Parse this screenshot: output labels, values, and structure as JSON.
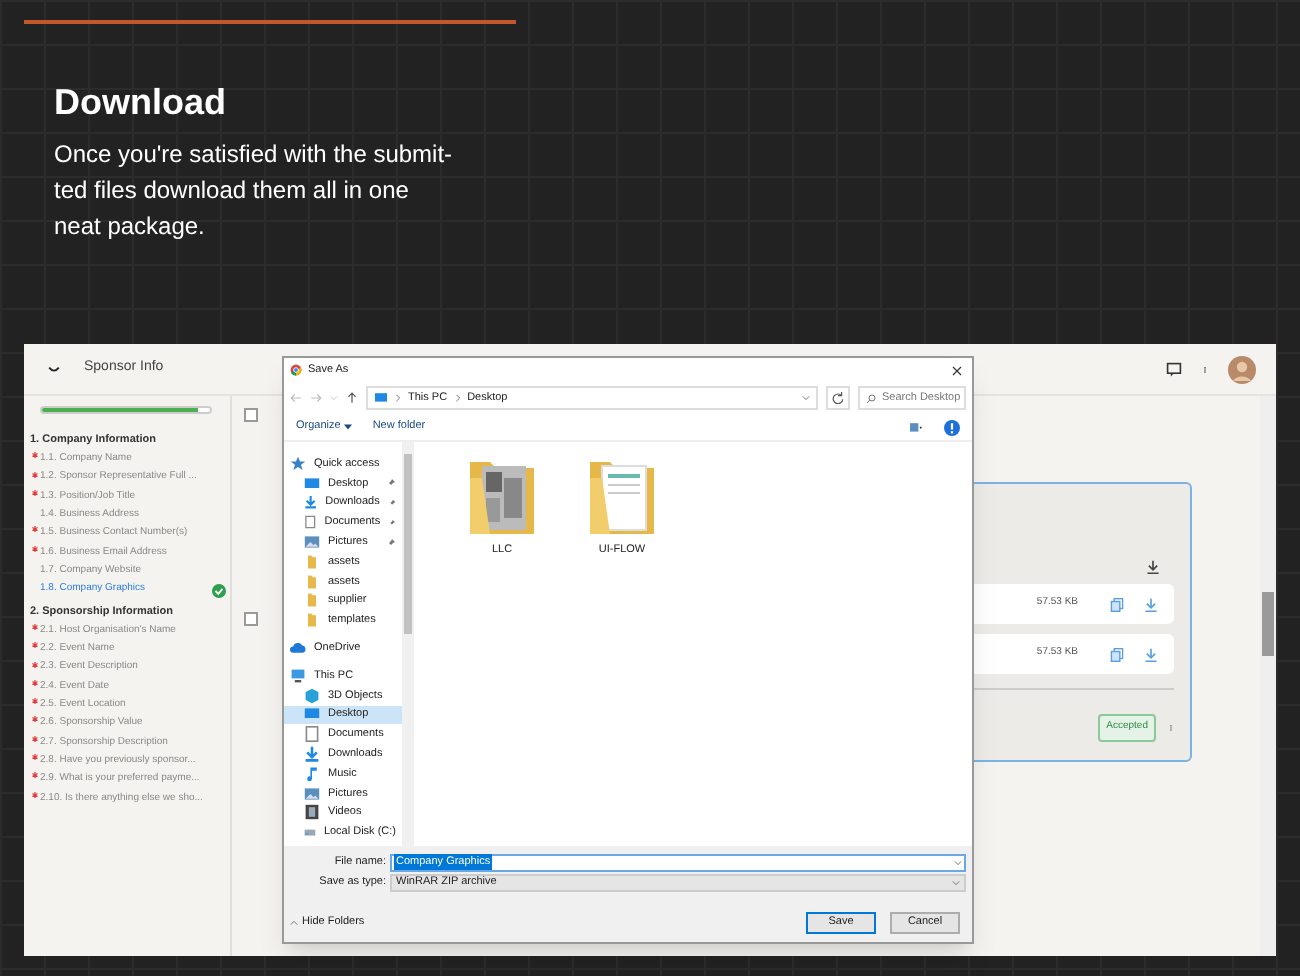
{
  "slide": {
    "title": "Download",
    "lines": [
      "Once you're satisfied with the submit-",
      "ted files download them all in one",
      "neat package."
    ]
  },
  "app": {
    "title": "Sponsor Info",
    "progress": {
      "level": 0.93
    },
    "sections": [
      {
        "number": "1.",
        "title": "Company Information",
        "items": [
          {
            "number": "1.1.",
            "label": "Company Name",
            "required": true,
            "selected": false,
            "completed": false
          },
          {
            "number": "1.2.",
            "label": "Sponsor Representative Full ...",
            "required": true,
            "selected": false,
            "completed": false
          },
          {
            "number": "1.3.",
            "label": "Position/Job Title",
            "required": true,
            "selected": false,
            "completed": false
          },
          {
            "number": "1.4.",
            "label": "Business Address",
            "required": false,
            "selected": false,
            "completed": false
          },
          {
            "number": "1.5.",
            "label": "Business Contact Number(s)",
            "required": true,
            "selected": false,
            "completed": false
          },
          {
            "number": "1.6.",
            "label": "Business Email Address",
            "required": true,
            "selected": false,
            "completed": false
          },
          {
            "number": "1.7.",
            "label": "Company Website",
            "required": false,
            "selected": false,
            "completed": false
          },
          {
            "number": "1.8.",
            "label": "Company Graphics",
            "required": false,
            "selected": true,
            "completed": true
          }
        ]
      },
      {
        "number": "2.",
        "title": "Sponsorship Information",
        "items": [
          {
            "number": "2.1.",
            "label": "Host Organisation's Name",
            "required": true,
            "selected": false,
            "completed": false
          },
          {
            "number": "2.2.",
            "label": "Event Name",
            "required": true,
            "selected": false,
            "completed": false
          },
          {
            "number": "2.3.",
            "label": "Event Description",
            "required": true,
            "selected": false,
            "completed": false
          },
          {
            "number": "2.4.",
            "label": "Event Date",
            "required": true,
            "selected": false,
            "completed": false
          },
          {
            "number": "2.5.",
            "label": "Event Location",
            "required": true,
            "selected": false,
            "completed": false
          },
          {
            "number": "2.6.",
            "label": "Sponsorship Value",
            "required": true,
            "selected": false,
            "completed": false
          },
          {
            "number": "2.7.",
            "label": "Sponsorship Description",
            "required": true,
            "selected": false,
            "completed": false
          },
          {
            "number": "2.8.",
            "label": "Have you previously sponsor...",
            "required": true,
            "selected": false,
            "completed": false
          },
          {
            "number": "2.9.",
            "label": "What is your preferred payme...",
            "required": true,
            "selected": false,
            "completed": false
          },
          {
            "number": "2.10.",
            "label": "Is there anything else we sho...",
            "required": true,
            "selected": false,
            "completed": false
          }
        ]
      }
    ],
    "checkboxes": [
      {
        "checked": false
      },
      {
        "checked": false
      }
    ],
    "files": [
      {
        "size": "57.53 KB"
      },
      {
        "size": "57.53 KB"
      }
    ],
    "status": "Accepted"
  },
  "dialog": {
    "title": "Save As",
    "path": [
      "This PC",
      "Desktop"
    ],
    "search_placeholder": "Search Desktop",
    "organize": "Organize",
    "new_folder": "New folder",
    "nav": [
      {
        "label": "Quick access",
        "kind": "star",
        "selected": false,
        "children": [
          {
            "label": "Desktop",
            "kind": "desktop",
            "pinned": true,
            "selected": false
          },
          {
            "label": "Downloads",
            "kind": "download",
            "pinned": true,
            "selected": false
          },
          {
            "label": "Documents",
            "kind": "document",
            "pinned": true,
            "selected": false
          },
          {
            "label": "Pictures",
            "kind": "pictures",
            "pinned": true,
            "selected": false
          },
          {
            "label": "assets",
            "kind": "folder",
            "pinned": false,
            "selected": false
          },
          {
            "label": "assets",
            "kind": "folder",
            "pinned": false,
            "selected": false
          },
          {
            "label": "supplier",
            "kind": "folder",
            "pinned": false,
            "selected": false
          },
          {
            "label": "templates",
            "kind": "folder",
            "pinned": false,
            "selected": false
          }
        ]
      },
      {
        "label": "OneDrive",
        "kind": "cloud",
        "selected": false
      },
      {
        "label": "This PC",
        "kind": "pc",
        "selected": false,
        "children": [
          {
            "label": "3D Objects",
            "kind": "cube",
            "pinned": false,
            "selected": false
          },
          {
            "label": "Desktop",
            "kind": "desktop",
            "pinned": false,
            "selected": true
          },
          {
            "label": "Documents",
            "kind": "document",
            "pinned": false,
            "selected": false
          },
          {
            "label": "Downloads",
            "kind": "download",
            "pinned": false,
            "selected": false
          },
          {
            "label": "Music",
            "kind": "music",
            "pinned": false,
            "selected": false
          },
          {
            "label": "Pictures",
            "kind": "pictures",
            "pinned": false,
            "selected": false
          },
          {
            "label": "Videos",
            "kind": "video",
            "pinned": false,
            "selected": false
          },
          {
            "label": "Local Disk (C:)",
            "kind": "disk",
            "pinned": false,
            "selected": false
          }
        ]
      }
    ],
    "folders": [
      {
        "name": "LLC"
      },
      {
        "name": "UI-FLOW"
      }
    ],
    "file_name_label": "File name:",
    "file_name": "Company Graphics",
    "type_label": "Save as type:",
    "type_value": "WinRAR ZIP archive",
    "hide_folders": "Hide Folders",
    "save": "Save",
    "cancel": "Cancel"
  }
}
